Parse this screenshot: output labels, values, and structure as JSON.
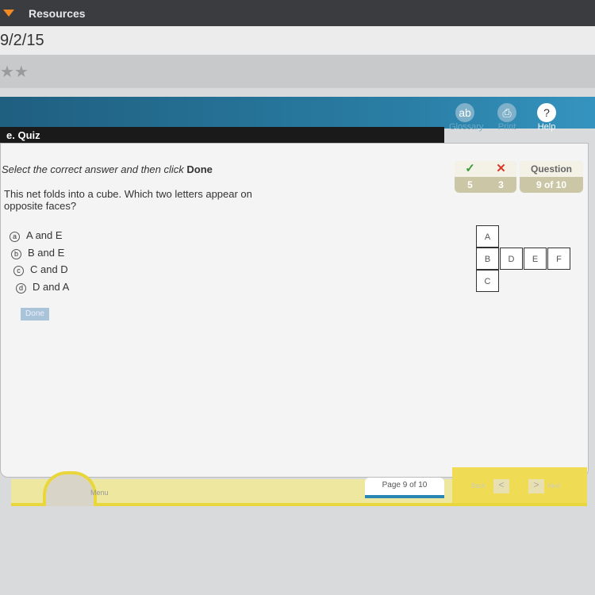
{
  "topbar": {
    "resources": "Resources"
  },
  "date": "9/2/15",
  "stars": "★★",
  "header": {
    "section": "e. Quiz",
    "tools": [
      {
        "label": "Glossary",
        "icon": "glossary-icon",
        "glyph": "ab"
      },
      {
        "label": "Print",
        "icon": "print-icon",
        "glyph": "⎙"
      },
      {
        "label": "Help",
        "icon": "help-icon",
        "glyph": "?"
      }
    ]
  },
  "quiz": {
    "instruction": "Select the correct answer and then click ",
    "instruction_bold": "Done",
    "question": "This net folds into a cube. Which two letters appear on opposite faces?",
    "options": [
      {
        "letter": "a",
        "text": "A and E"
      },
      {
        "letter": "b",
        "text": "B and E"
      },
      {
        "letter": "c",
        "text": "C and D"
      },
      {
        "letter": "d",
        "text": "D and A"
      }
    ],
    "done_label": "Done",
    "score": {
      "correct_mark": "✓",
      "wrong_mark": "✕",
      "correct": "5",
      "wrong": "3",
      "question_label": "Question",
      "question_progress": "9 of 10"
    },
    "net": [
      "A",
      "B",
      "D",
      "E",
      "F",
      "C"
    ]
  },
  "footer": {
    "menu": "Menu",
    "page": "Page 9 of 10",
    "back": "Back",
    "next": "Next",
    "back_glyph": "<",
    "next_glyph": ">"
  }
}
